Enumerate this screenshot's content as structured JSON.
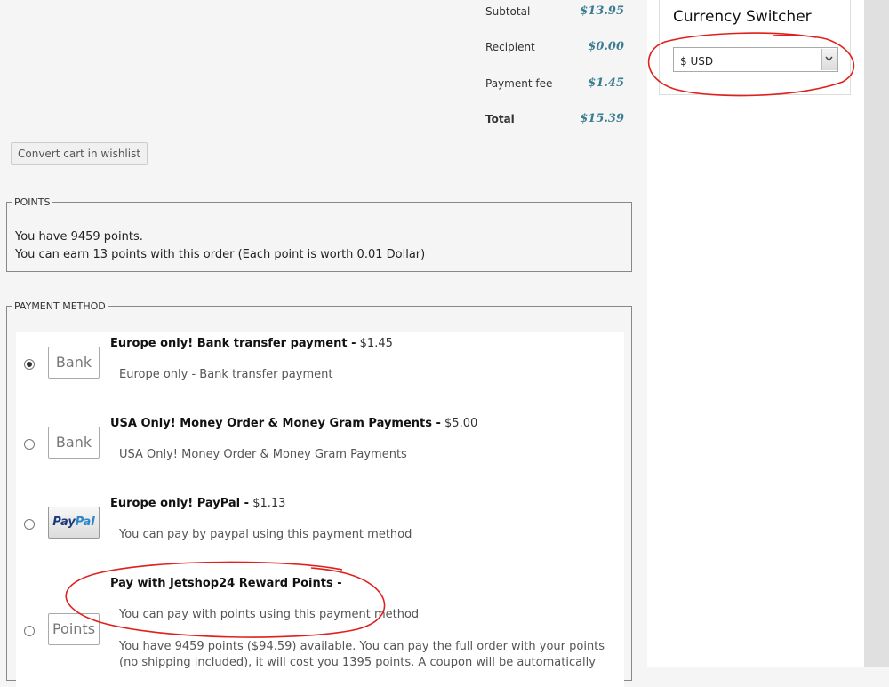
{
  "totals": {
    "subtotal_label": "Subtotal",
    "subtotal_value": "$13.95",
    "recipient_label": "Recipient",
    "recipient_value": "$0.00",
    "fee_label": "Payment fee",
    "fee_value": "$1.45",
    "total_label": "Total",
    "total_value": "$15.39"
  },
  "wishlist_button": "Convert cart in wishlist",
  "points": {
    "legend": "POINTS",
    "line1": "You have 9459 points.",
    "line2": "You can earn 13 points with this order (Each point is worth 0.01 Dollar)"
  },
  "payment": {
    "legend": "PAYMENT METHOD",
    "methods": [
      {
        "logo": "Bank",
        "title": "Europe only! Bank transfer payment -",
        "price": " $1.45",
        "description": "Europe only - Bank transfer payment",
        "selected": true
      },
      {
        "logo": "Bank",
        "title": "USA Only! Money Order & Money Gram Payments -",
        "price": " $5.00",
        "description": "USA Only! Money Order & Money Gram Payments",
        "selected": false
      },
      {
        "logo_part1": "Pay",
        "logo_part2": "Pal",
        "title": "Europe only! PayPal -",
        "price": " $1.13",
        "description": "You can pay by paypal using this payment method",
        "selected": false
      },
      {
        "logo": "Points",
        "title": "Pay with Jetshop24 Reward Points -",
        "price": "",
        "description": "You can pay with points using this payment method",
        "extra": "You have 9459 points ($94.59) available. You can pay the full order with your points (no shipping included), it will cost you 1395 points. A coupon will be automatically",
        "selected": false
      }
    ]
  },
  "currency_switcher": {
    "title": "Currency Switcher",
    "selected": "$ USD"
  },
  "colors": {
    "price_accent": "#3c7c90",
    "annotation_red": "#e0201c"
  }
}
